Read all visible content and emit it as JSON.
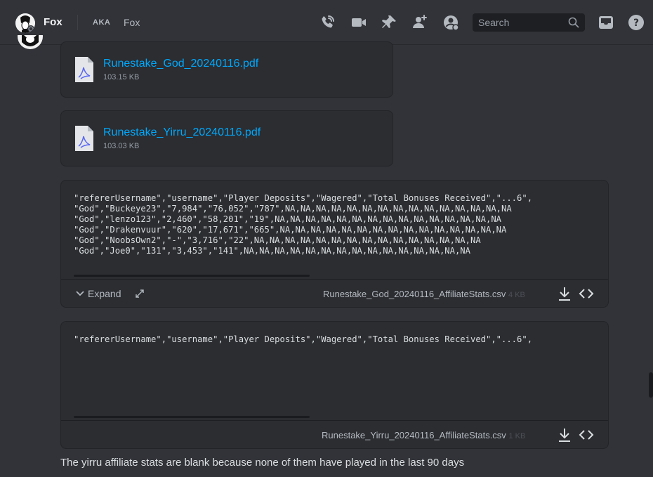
{
  "header": {
    "title": "Fox",
    "aka_label": "AKA",
    "aka_name": "Fox",
    "search_placeholder": "Search",
    "icons": [
      "call-icon",
      "video-icon",
      "pin-icon",
      "add-friend-icon",
      "profile-icon",
      "search-icon",
      "inbox-icon",
      "help-icon"
    ]
  },
  "files": [
    {
      "name": "Runestake_God_20240116.pdf",
      "size": "103.15 KB"
    },
    {
      "name": "Runestake_Yirru_20240116.pdf",
      "size": "103.03 KB"
    }
  ],
  "csv_previews": [
    {
      "lines": [
        "\"refererUsername\",\"username\",\"Player Deposits\",\"Wagered\",\"Total Bonuses Received\",\"...6\",",
        "\"God\",\"Buckeye23\",\"7,984\",\"76,052\",\"787\",NA,NA,NA,NA,NA,NA,NA,NA,NA,NA,NA,NA,NA,NA,NA",
        "\"God\",\"lenzo123\",\"2,460\",\"58,201\",\"19\",NA,NA,NA,NA,NA,NA,NA,NA,NA,NA,NA,NA,NA,NA,NA",
        "\"God\",\"Drakenvuur\",\"620\",\"17,671\",\"665\",NA,NA,NA,NA,NA,NA,NA,NA,NA,NA,NA,NA,NA,NA,NA",
        "\"God\",\"NoobsOwn2\",\"-\",\"3,716\",\"22\",NA,NA,NA,NA,NA,NA,NA,NA,NA,NA,NA,NA,NA,NA,NA",
        "\"God\",\"Joe0\",\"131\",\"3,453\",\"141\",NA,NA,NA,NA,NA,NA,NA,NA,NA,NA,NA,NA,NA,NA,NA"
      ],
      "expand_label": "Expand",
      "filename": "Runestake_God_20240116_AffiliateStats.csv",
      "filesize": "4 KB"
    },
    {
      "lines": [
        "\"refererUsername\",\"username\",\"Player Deposits\",\"Wagered\",\"Total Bonuses Received\",\"...6\","
      ],
      "filename": "Runestake_Yirru_20240116_AffiliateStats.csv",
      "filesize": "1 KB"
    }
  ],
  "message": "The yirru affiliate stats are blank because none of them have played in the last 90 days",
  "colors": {
    "background": "#313338",
    "card": "#2b2d31",
    "link": "#00a8fc",
    "text": "#dbdee1",
    "muted": "#949ba4"
  }
}
